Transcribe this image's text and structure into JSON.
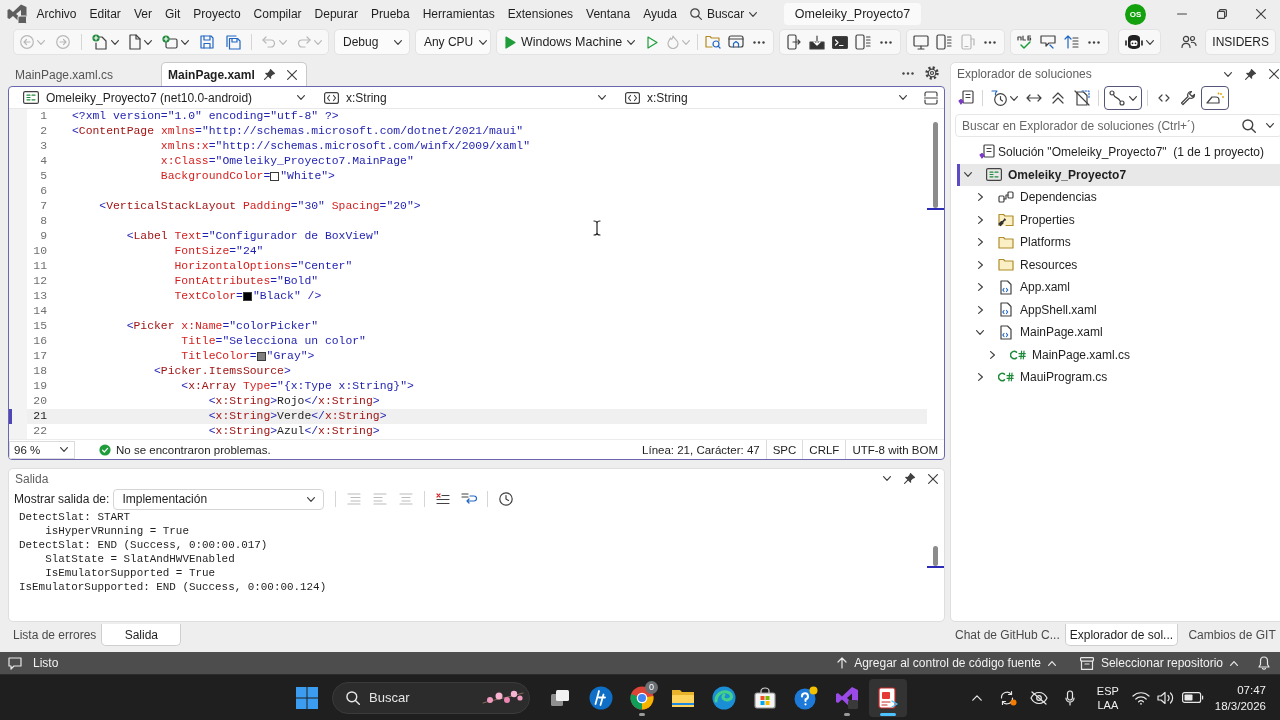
{
  "menu_bar": {
    "items": [
      "Archivo",
      "Editar",
      "Ver",
      "Git",
      "Proyecto",
      "Compilar",
      "Depurar",
      "Prueba",
      "Herramientas",
      "Extensiones",
      "Ventana",
      "Ayuda"
    ],
    "search": "Buscar",
    "solution_name": "Omeleiky_Proyecto7",
    "avatar": "OS"
  },
  "toolbar": {
    "edit_buttons": [
      {
        "disabled": true
      },
      {
        "disabled": true
      },
      {
        "disabled": false
      },
      {
        "disabled": false
      },
      {
        "disabled": false
      },
      {
        "disabled": false
      },
      {
        "disabled": false
      },
      {
        "disabled": true
      },
      {
        "disabled": true
      }
    ],
    "configuration": "Debug",
    "platform": "Any CPU",
    "run_target": "Windows Machine",
    "run_buttons": [
      {
        "disabled": false
      },
      {
        "disabled": true
      },
      {
        "disabled": false
      },
      {
        "disabled": false
      }
    ],
    "device_buttons": [
      {
        "disabled": false
      },
      {
        "disabled": false
      },
      {
        "disabled": false
      },
      {
        "disabled": false
      }
    ],
    "view_buttons": [
      {
        "disabled": false
      },
      {
        "disabled": false
      },
      {
        "disabled": true
      }
    ],
    "text_buttons": [
      {
        "disabled": false
      },
      {
        "disabled": false
      },
      {
        "disabled": false
      }
    ],
    "channel": "INSIDERS"
  },
  "editor": {
    "tabs": [
      {
        "label": "MainPage.xaml.cs",
        "selected": false
      },
      {
        "label": "MainPage.xaml",
        "selected": true
      }
    ],
    "nav": [
      "Omeleiky_Proyecto7 (net10.0-android)",
      "x:String",
      "x:String"
    ],
    "lines": [
      {
        "number": "1",
        "current": false,
        "tokens": [
          {
            "kind": "delim",
            "text": "<?xml version=\"1.0\" encoding=\"utf-8\" ?>"
          }
        ]
      },
      {
        "number": "2",
        "current": false,
        "tokens": [
          {
            "kind": "delim",
            "text": "<"
          },
          {
            "kind": "element",
            "text": "ContentPage"
          },
          {
            "kind": "attribute",
            "text": " xmlns"
          },
          {
            "kind": "delim",
            "text": "="
          },
          {
            "kind": "value",
            "text": "\"http://schemas.microsoft.com/dotnet/2021/maui\""
          }
        ]
      },
      {
        "number": "3",
        "current": false,
        "tokens": [
          {
            "kind": "attribute",
            "text": "             xmlns:x"
          },
          {
            "kind": "delim",
            "text": "="
          },
          {
            "kind": "value",
            "text": "\"http://schemas.microsoft.com/winfx/2009/xaml\""
          }
        ]
      },
      {
        "number": "4",
        "current": false,
        "tokens": [
          {
            "kind": "attribute",
            "text": "             x:Class"
          },
          {
            "kind": "delim",
            "text": "="
          },
          {
            "kind": "value",
            "text": "\"Omeleiky_Proyecto7.MainPage\""
          }
        ]
      },
      {
        "number": "5",
        "current": false,
        "tokens": [
          {
            "kind": "attribute",
            "text": "             BackgroundColor"
          },
          {
            "kind": "delim",
            "text": "="
          },
          {
            "kind": "swatch",
            "color": "#ffffff"
          },
          {
            "kind": "value",
            "text": "\"White\""
          },
          {
            "kind": "delim",
            "text": ">"
          }
        ]
      },
      {
        "number": "6",
        "current": false
      },
      {
        "number": "7",
        "current": false,
        "tokens": [
          {
            "kind": "delim",
            "text": "    <"
          },
          {
            "kind": "element",
            "text": "VerticalStackLayout"
          },
          {
            "kind": "attribute",
            "text": " Padding"
          },
          {
            "kind": "delim",
            "text": "="
          },
          {
            "kind": "value",
            "text": "\"30\""
          },
          {
            "kind": "attribute",
            "text": " Spacing"
          },
          {
            "kind": "delim",
            "text": "="
          },
          {
            "kind": "value",
            "text": "\"20\""
          },
          {
            "kind": "delim",
            "text": ">"
          }
        ]
      },
      {
        "number": "8",
        "current": false
      },
      {
        "number": "9",
        "current": false,
        "tokens": [
          {
            "kind": "delim",
            "text": "        <"
          },
          {
            "kind": "element",
            "text": "Label"
          },
          {
            "kind": "attribute",
            "text": " Text"
          },
          {
            "kind": "delim",
            "text": "="
          },
          {
            "kind": "value",
            "text": "\"Configurador de BoxView\""
          }
        ]
      },
      {
        "number": "10",
        "current": false,
        "tokens": [
          {
            "kind": "attribute",
            "text": "               FontSize"
          },
          {
            "kind": "delim",
            "text": "="
          },
          {
            "kind": "value",
            "text": "\"24\""
          }
        ]
      },
      {
        "number": "11",
        "current": false,
        "tokens": [
          {
            "kind": "attribute",
            "text": "               HorizontalOptions"
          },
          {
            "kind": "delim",
            "text": "="
          },
          {
            "kind": "value",
            "text": "\"Center\""
          }
        ]
      },
      {
        "number": "12",
        "current": false,
        "tokens": [
          {
            "kind": "attribute",
            "text": "               FontAttributes"
          },
          {
            "kind": "delim",
            "text": "="
          },
          {
            "kind": "value",
            "text": "\"Bold\""
          }
        ]
      },
      {
        "number": "13",
        "current": false,
        "tokens": [
          {
            "kind": "attribute",
            "text": "               TextColor"
          },
          {
            "kind": "delim",
            "text": "="
          },
          {
            "kind": "swatch",
            "color": "#000000"
          },
          {
            "kind": "value",
            "text": "\"Black\""
          },
          {
            "kind": "delim",
            "text": " />"
          }
        ]
      },
      {
        "number": "14",
        "current": false
      },
      {
        "number": "15",
        "current": false,
        "tokens": [
          {
            "kind": "delim",
            "text": "        <"
          },
          {
            "kind": "element",
            "text": "Picker"
          },
          {
            "kind": "attribute",
            "text": " x:Name"
          },
          {
            "kind": "delim",
            "text": "="
          },
          {
            "kind": "value",
            "text": "\"colorPicker\""
          }
        ]
      },
      {
        "number": "16",
        "current": false,
        "tokens": [
          {
            "kind": "attribute",
            "text": "                Title"
          },
          {
            "kind": "delim",
            "text": "="
          },
          {
            "kind": "value",
            "text": "\"Selecciona un color\""
          }
        ]
      },
      {
        "number": "17",
        "current": false,
        "tokens": [
          {
            "kind": "attribute",
            "text": "                TitleColor"
          },
          {
            "kind": "delim",
            "text": "="
          },
          {
            "kind": "swatch",
            "color": "#808080"
          },
          {
            "kind": "value",
            "text": "\"Gray\""
          },
          {
            "kind": "delim",
            "text": ">"
          }
        ]
      },
      {
        "number": "18",
        "current": false,
        "tokens": [
          {
            "kind": "delim",
            "text": "            <"
          },
          {
            "kind": "element",
            "text": "Picker.ItemsSource"
          },
          {
            "kind": "delim",
            "text": ">"
          }
        ]
      },
      {
        "number": "19",
        "current": false,
        "tokens": [
          {
            "kind": "delim",
            "text": "                <"
          },
          {
            "kind": "element",
            "text": "x:Array"
          },
          {
            "kind": "attribute",
            "text": " Type"
          },
          {
            "kind": "delim",
            "text": "="
          },
          {
            "kind": "value",
            "text": "\"{x:Type x:String}\""
          },
          {
            "kind": "delim",
            "text": ">"
          }
        ]
      },
      {
        "number": "20",
        "current": false,
        "tokens": [
          {
            "kind": "delim",
            "text": "                    <"
          },
          {
            "kind": "element",
            "text": "x:String"
          },
          {
            "kind": "delim",
            "text": ">"
          },
          {
            "kind": "text",
            "text": "Rojo"
          },
          {
            "kind": "delim",
            "text": "</"
          },
          {
            "kind": "element",
            "text": "x:String"
          },
          {
            "kind": "delim",
            "text": ">"
          }
        ]
      },
      {
        "number": "21",
        "current": true,
        "tokens": [
          {
            "kind": "delim",
            "text": "                    <"
          },
          {
            "kind": "element",
            "text": "x:String"
          },
          {
            "kind": "delim",
            "text": ">"
          },
          {
            "kind": "text",
            "text": "Verde"
          },
          {
            "kind": "delim",
            "text": "</"
          },
          {
            "kind": "element",
            "text": "x:String"
          },
          {
            "kind": "delim",
            "text": ">"
          }
        ]
      },
      {
        "number": "22",
        "current": false,
        "tokens": [
          {
            "kind": "delim",
            "text": "                    <"
          },
          {
            "kind": "element",
            "text": "x:String"
          },
          {
            "kind": "delim",
            "text": ">"
          },
          {
            "kind": "text",
            "text": "Azul"
          },
          {
            "kind": "delim",
            "text": "</"
          },
          {
            "kind": "element",
            "text": "x:String"
          },
          {
            "kind": "delim",
            "text": ">"
          }
        ]
      }
    ],
    "status": {
      "zoom": "96 %",
      "problems": "No se encontraron problemas.",
      "position": "Línea: 21, Carácter: 47",
      "indentation": "SPC",
      "line_endings": "CRLF",
      "encoding": "UTF-8 with BOM"
    }
  },
  "output": {
    "title": "Salida",
    "source_label": "Mostrar salida de:",
    "source": "Implementación",
    "tools": [
      {
        "disabled": true
      },
      {
        "disabled": true
      },
      {
        "disabled": true
      },
      {
        "disabled": false
      },
      {
        "disabled": false
      },
      {
        "disabled": false
      }
    ],
    "lines": [
      "DetectSlat: START",
      "    isHyperVRunning = True",
      "DetectSlat: END (Success, 0:00:00.017)",
      "    SlatState = SlatAndHWVEnabled",
      "    IsEmulatorSupported = True",
      "IsEmulatorSupported: END (Success, 0:00:00.124)"
    ]
  },
  "pane_tabs_left": [
    {
      "label": "Lista de errores",
      "selected": false
    },
    {
      "label": "Salida",
      "selected": true
    }
  ],
  "solution_explorer": {
    "title": "Explorador de soluciones",
    "toggles": [
      {
        "on": true
      },
      {
        "on": true
      }
    ],
    "search": {
      "placeholder": "Buscar en Explorador de soluciones (Ctrl+´)"
    },
    "solution": "Solución \"Omeleiky_Proyecto7\"  (1 de 1 proyecto)",
    "tree": [
      {
        "label": "Omeleiky_Proyecto7",
        "kind": "project",
        "startup": true,
        "expanded": true,
        "selected": true,
        "children": [
          {
            "label": "Dependencias",
            "kind": "dependencies",
            "expanded": false,
            "selected": false
          },
          {
            "label": "Properties",
            "kind": "properties",
            "expanded": false,
            "selected": false
          },
          {
            "label": "Platforms",
            "kind": "folder",
            "expanded": false,
            "selected": false
          },
          {
            "label": "Resources",
            "kind": "folder",
            "expanded": false,
            "selected": false
          },
          {
            "label": "App.xaml",
            "kind": "xaml",
            "expanded": false,
            "selected": false
          },
          {
            "label": "AppShell.xaml",
            "kind": "xaml",
            "expanded": false,
            "selected": false
          },
          {
            "label": "MainPage.xaml",
            "kind": "xaml",
            "expanded": true,
            "selected": false,
            "children": [
              {
                "label": "MainPage.xaml.cs",
                "kind": "csharp",
                "expanded": false,
                "selected": false
              }
            ]
          },
          {
            "label": "MauiProgram.cs",
            "kind": "csharp",
            "expanded": false,
            "selected": false
          }
        ]
      }
    ]
  },
  "pane_tabs_right": [
    {
      "label": "Chat de GitHub C...",
      "selected": false
    },
    {
      "label": "Explorador de sol...",
      "selected": true
    },
    {
      "label": "Cambios de GIT",
      "selected": false
    }
  ],
  "status_bar": {
    "state": "Listo",
    "source_control": "Agregar al control de código fuente",
    "repository": "Seleccionar repositorio"
  },
  "taskbar": {
    "search": {
      "placeholder": "Buscar"
    },
    "apps": [
      {
        "kind": "task_view",
        "running": false,
        "selected": false
      },
      {
        "kind": "circle_logo",
        "running": false,
        "selected": false
      },
      {
        "kind": "ring_logo",
        "running": true,
        "selected": false,
        "badge": "0"
      },
      {
        "kind": "files",
        "running": false,
        "selected": false
      },
      {
        "kind": "swirl",
        "running": false,
        "selected": false
      },
      {
        "kind": "store",
        "running": false,
        "selected": false
      },
      {
        "kind": "tips",
        "running": false,
        "selected": false
      },
      {
        "kind": "ribbon",
        "running": true,
        "selected": false
      },
      {
        "kind": "recorder",
        "running": true,
        "selected": true
      }
    ],
    "language": "ESP",
    "layout": "LAA",
    "time": "07:47",
    "date": "18/3/2026"
  }
}
